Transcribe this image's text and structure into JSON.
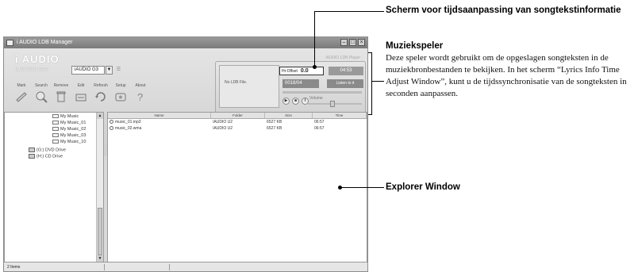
{
  "window": {
    "title": "i AUDIO LDB Manager",
    "logo": "AUDIO",
    "logo_prefix": "i",
    "subtitle": "Lyric Data Base",
    "device": "iAUDIO G3",
    "toolbar": [
      {
        "label": "Mark",
        "icon": "mark-icon"
      },
      {
        "label": "Search",
        "icon": "search-icon"
      },
      {
        "label": "Remove",
        "icon": "remove-icon"
      },
      {
        "label": "Edit",
        "icon": "edit-icon"
      },
      {
        "label": "Refresh",
        "icon": "refresh-icon"
      },
      {
        "label": "Setup",
        "icon": "setup-icon"
      },
      {
        "label": "About",
        "icon": "about-icon"
      }
    ],
    "player": {
      "title": "iAUDIO LDB Player",
      "lcd_text": "No LDB File.",
      "time_adjust_label": "Hr:Offset",
      "time_adjust_value": "0.0",
      "clock": "04:53",
      "track": "0018/04",
      "listen_label": "Listen to it",
      "volume_label": "Volume",
      "progress": 0.0
    },
    "tree": [
      {
        "label": "My Music",
        "type": "folder"
      },
      {
        "label": "My Music_01",
        "type": "folder"
      },
      {
        "label": "My Music_02",
        "type": "folder"
      },
      {
        "label": "My Music_03",
        "type": "folder"
      },
      {
        "label": "My Music_10",
        "type": "folder"
      },
      {
        "label": "(G:) DVD Drive",
        "type": "drive"
      },
      {
        "label": "(H:) CD Drive",
        "type": "drive"
      }
    ],
    "explorer": {
      "columns": [
        "Name",
        "Folder",
        "Size",
        "Time"
      ],
      "rows": [
        [
          "music_01.mp3",
          "\\AUDIO U2",
          "6527 KB",
          "06:57"
        ],
        [
          "music_02.wma",
          "\\AUDIO U2",
          "6527 KB",
          "06:57"
        ]
      ]
    },
    "status": "2 Items"
  },
  "annotations": {
    "time_adjust": "Scherm voor tijdsaanpassing van songtekstinformatie",
    "player_title": "Muziekspeler",
    "player_desc": "Deze speler wordt gebruikt om de opgeslagen songteksten in de muziekbronbestanden te bekijken. In het scherm “Lyrics Info Time Adjust Window”, kunt u de tijdssynchronisatie van de songteksten in seconden aanpassen.",
    "explorer": "Explorer Window"
  }
}
